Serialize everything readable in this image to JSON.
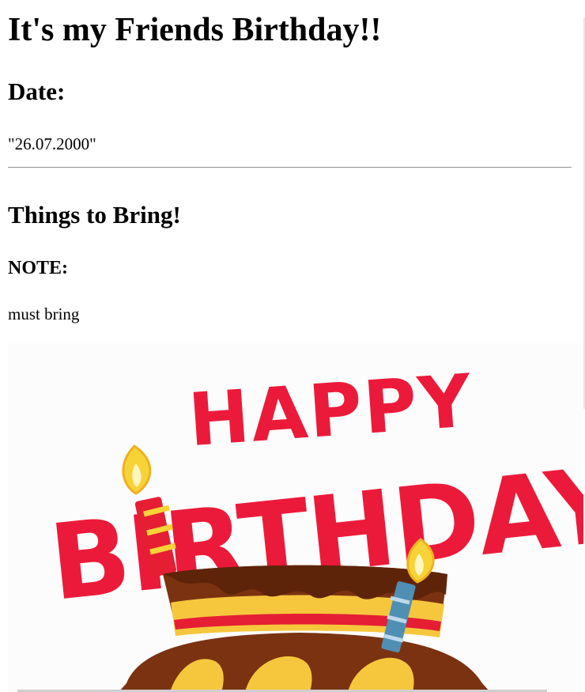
{
  "page": {
    "title": "It's my Friends Birthday!!",
    "date_heading": "Date:",
    "date_value": "\"26.07.2000\"",
    "things_heading": "Things to Bring!",
    "note_heading": "NOTE:",
    "note_text": "must bring"
  },
  "banner": {
    "line1": "HAPPY",
    "line2": "BIRTHDAY",
    "text_color": "#ec1a3a",
    "cake_color": "#7a3211",
    "icing_color": "#f6c73d",
    "stripe_color": "#e51e34",
    "candle_color": "#4f8fb4",
    "flame_color": "#f7d337"
  }
}
